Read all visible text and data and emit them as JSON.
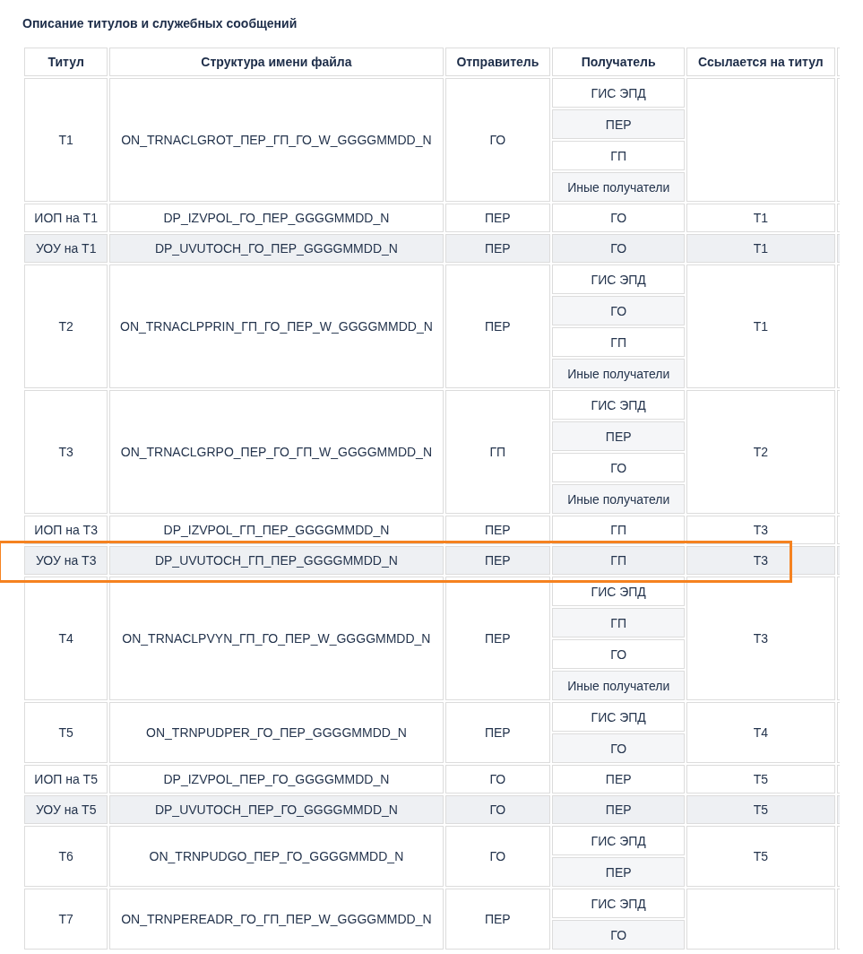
{
  "title": "Описание титулов и служебных сообщений",
  "table": {
    "columns": [
      "Титул",
      "Структура имени файла",
      "Отправитель",
      "Получатель",
      "Ссылается на титул"
    ],
    "rows": [
      {
        "title": "Т1",
        "filename": "ON_TRNACLGROT_ПЕР_ГП_ГО_W_GGGGMMDD_N",
        "sender": "ГО",
        "recipients": [
          "ГИС ЭПД",
          "ПЕР",
          "ГП",
          "Иные получатели"
        ],
        "reference": "",
        "shaded": false,
        "highlighted": false
      },
      {
        "title": "ИОП на Т1",
        "filename": "DP_IZVPOL_ГО_ПЕР_GGGGMMDD_N",
        "sender": "ПЕР",
        "recipients": [
          "ГО"
        ],
        "reference": "Т1",
        "shaded": false,
        "highlighted": false
      },
      {
        "title": "УОУ на Т1",
        "filename": "DP_UVUTOCH_ГО_ПЕР_GGGGMMDD_N",
        "sender": "ПЕР",
        "recipients": [
          "ГО"
        ],
        "reference": "Т1",
        "shaded": true,
        "highlighted": false
      },
      {
        "title": "Т2",
        "filename": "ON_TRNACLPPRIN_ГП_ГО_ПЕР_W_GGGGMMDD_N",
        "sender": "ПЕР",
        "recipients": [
          "ГИС ЭПД",
          "ГО",
          "ГП",
          "Иные получатели"
        ],
        "reference": "Т1",
        "shaded": false,
        "highlighted": false
      },
      {
        "title": "Т3",
        "filename": "ON_TRNACLGRPO_ПЕР_ГО_ГП_W_GGGGMMDD_N",
        "sender": "ГП",
        "recipients": [
          "ГИС ЭПД",
          "ПЕР",
          "ГО",
          "Иные получатели"
        ],
        "reference": "Т2",
        "shaded": false,
        "highlighted": false
      },
      {
        "title": "ИОП на Т3",
        "filename": "DP_IZVPOL_ГП_ПЕР_GGGGMMDD_N",
        "sender": "ПЕР",
        "recipients": [
          "ГП"
        ],
        "reference": "Т3",
        "shaded": false,
        "highlighted": false
      },
      {
        "title": "УОУ на Т3",
        "filename": "DP_UVUTOCH_ГП_ПЕР_GGGGMMDD_N",
        "sender": "ПЕР",
        "recipients": [
          "ГП"
        ],
        "reference": "Т3",
        "shaded": true,
        "highlighted": true
      },
      {
        "title": "Т4",
        "filename": "ON_TRNACLPVYN_ГП_ГО_ПЕР_W_GGGGMMDD_N",
        "sender": "ПЕР",
        "recipients": [
          "ГИС ЭПД",
          "ГП",
          "ГО",
          "Иные получатели"
        ],
        "reference": "Т3",
        "shaded": false,
        "highlighted": false
      },
      {
        "title": "Т5",
        "filename": "ON_TRNPUDPER_ГО_ПЕР_GGGGMMDD_N",
        "sender": "ПЕР",
        "recipients": [
          "ГИС ЭПД",
          "ГО"
        ],
        "reference": "Т4",
        "shaded": false,
        "highlighted": false
      },
      {
        "title": "ИОП на Т5",
        "filename": "DP_IZVPOL_ПЕР_ГО_GGGGMMDD_N",
        "sender": "ГО",
        "recipients": [
          "ПЕР"
        ],
        "reference": "Т5",
        "shaded": false,
        "highlighted": false
      },
      {
        "title": "УОУ на Т5",
        "filename": "DP_UVUTOCH_ПЕР_ГО_GGGGMMDD_N",
        "sender": "ГО",
        "recipients": [
          "ПЕР"
        ],
        "reference": "Т5",
        "shaded": true,
        "highlighted": false
      },
      {
        "title": "Т6",
        "filename": "ON_TRNPUDGO_ПЕР_ГО_GGGGMMDD_N",
        "sender": "ГО",
        "recipients": [
          "ГИС ЭПД",
          "ПЕР"
        ],
        "reference": "Т5",
        "shaded": false,
        "highlighted": false
      },
      {
        "title": "Т7",
        "filename": "ON_TRNPEREADR_ГО_ГП_ПЕР_W_GGGGMMDD_N",
        "sender": "ПЕР",
        "recipients": [
          "ГИС ЭПД",
          "ГО"
        ],
        "reference": "",
        "shaded": false,
        "highlighted": false
      }
    ]
  }
}
